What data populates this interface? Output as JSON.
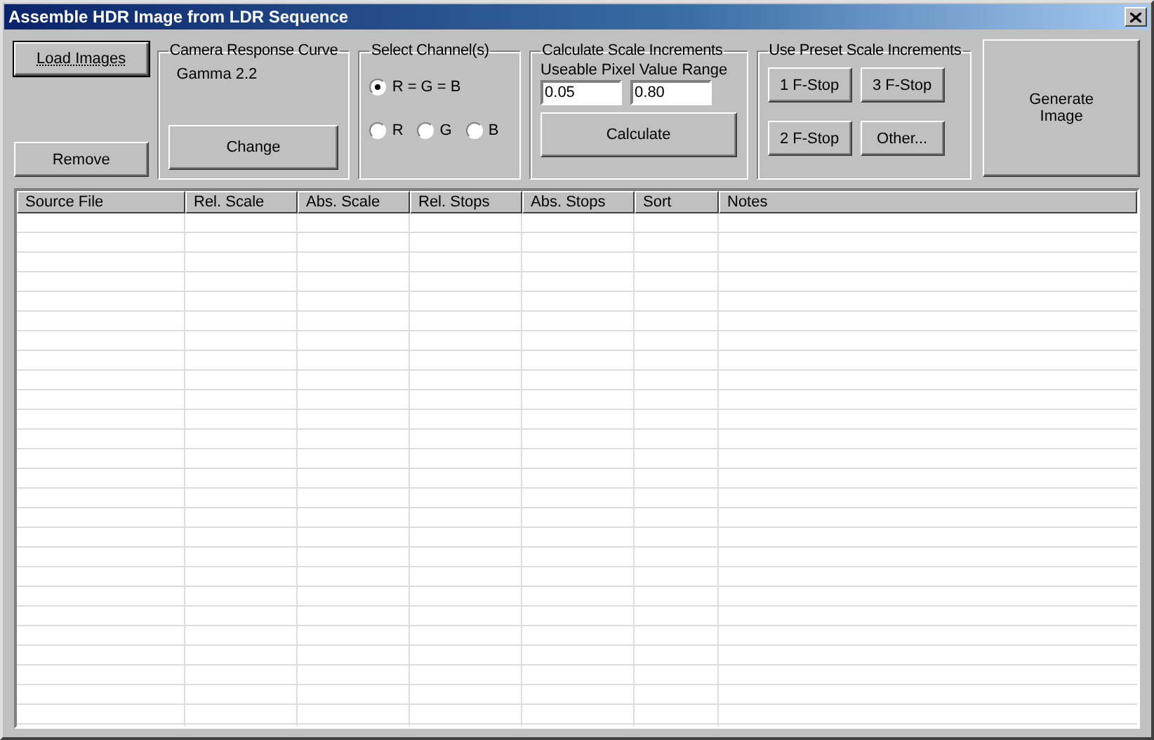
{
  "window": {
    "title": "Assemble HDR Image from LDR Sequence"
  },
  "load_button": {
    "label": "Load Images",
    "focused": true
  },
  "remove_button": {
    "label": "Remove"
  },
  "camera_group": {
    "title": "Camera Response Curve",
    "value": "Gamma 2.2",
    "button": "Change"
  },
  "channel_group": {
    "title": "Select Channel(s)",
    "rows": [
      [
        {
          "label": "R = G = B",
          "selected": true
        }
      ],
      [
        {
          "label": "R",
          "selected": false
        },
        {
          "label": "G",
          "selected": false
        },
        {
          "label": "B",
          "selected": false
        }
      ]
    ]
  },
  "calc_group": {
    "title": "Calculate Scale Increments",
    "range_label": "Useable Pixel Value Range",
    "min": "0.05",
    "max": "0.80",
    "button": "Calculate"
  },
  "preset_group": {
    "title": "Use Preset Scale Increments",
    "buttons": [
      "1 F-Stop",
      "3 F-Stop",
      "2 F-Stop",
      "Other..."
    ]
  },
  "generate_button": {
    "label": "Generate Image"
  },
  "table": {
    "columns": [
      "Source File",
      "Rel. Scale",
      "Abs. Scale",
      "Rel. Stops",
      "Abs. Stops",
      "Sort",
      "Notes"
    ]
  }
}
